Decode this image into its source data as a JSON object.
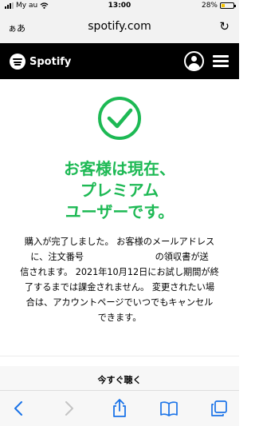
{
  "status_bar": {
    "carrier": "My au",
    "time": "13:00",
    "battery_percent": "28%",
    "battery_level": 0.28
  },
  "browser": {
    "aa_label": "ぁあ",
    "domain": "spotify.com",
    "reload_icon": "reload-icon"
  },
  "header": {
    "brand": "Spotify",
    "logo_icon": "spotify-logo-icon",
    "account_icon": "account-icon",
    "menu_icon": "hamburger-menu-icon",
    "bg_color": "#000000"
  },
  "main": {
    "check_icon": "check-circle-icon",
    "accent_color": "#1db954",
    "headline_lines": [
      "お客様は現在、",
      "プレミアム",
      "ユーザーです。"
    ],
    "message_lines": [
      "購入が完了しました。 お客様のメールアドレス",
      "に、注文番号　　　　　　　　の領収書が送",
      "信されます。 2021年10月12日にお試し期間が終",
      "了するまでは課金されません。 変更されたい場",
      "合は、アカウントページでいつでもキャンセル",
      "できます。"
    ]
  },
  "listen_now": {
    "label": "今すぐ聴く"
  },
  "toolbar": {
    "icons": [
      "back-icon",
      "forward-icon",
      "share-icon",
      "bookmarks-icon",
      "tabs-icon"
    ]
  }
}
